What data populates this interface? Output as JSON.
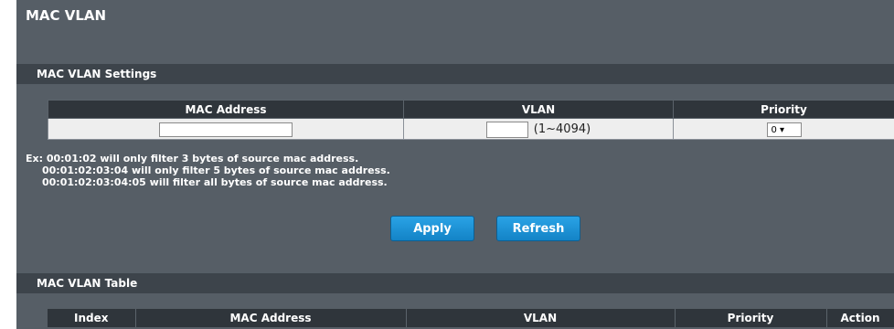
{
  "page_title": "MAC VLAN",
  "settings": {
    "header": "MAC VLAN Settings",
    "columns": [
      "MAC Address",
      "VLAN",
      "Priority"
    ],
    "mac_value": "",
    "vlan_value": "",
    "vlan_range": "(1~4094)",
    "priority_value": "0 ▾"
  },
  "example": {
    "line1": "Ex: 00:01:02 will only filter 3 bytes of source mac address.",
    "line2": "00:01:02:03:04 will only filter 5 bytes of source mac address.",
    "line3": "00:01:02:03:04:05 will filter all bytes of source mac address."
  },
  "buttons": {
    "apply": "Apply",
    "refresh": "Refresh"
  },
  "table": {
    "header": "MAC VLAN Table",
    "columns": [
      "Index",
      "MAC Address",
      "VLAN",
      "Priority",
      "Action"
    ]
  }
}
